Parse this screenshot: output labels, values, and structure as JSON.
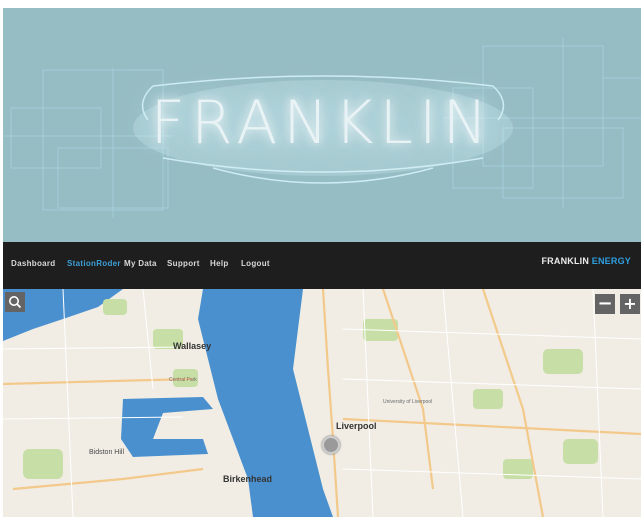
{
  "header": {
    "logo_text": "FRANKLIN"
  },
  "nav": {
    "items": [
      {
        "label": "Dashboard",
        "active": false
      },
      {
        "label": "StationRoder",
        "active": true
      },
      {
        "label": "My Data",
        "active": false
      },
      {
        "label": "Support",
        "active": false
      },
      {
        "label": "Help",
        "active": false
      },
      {
        "label": "Logout",
        "active": false
      }
    ],
    "brand_part1": "FRANKLIN",
    "brand_part2": "ENERGY"
  },
  "map": {
    "search_icon": "search-icon",
    "zoom_out_label": "−",
    "zoom_in_label": "+",
    "labels": {
      "wallasey": "Wallasey",
      "liverpool": "Liverpool",
      "birkenhead": "Birkenhead",
      "bidston_hill": "Bidston Hill",
      "central_park": "Central Park",
      "university": "University of Liverpool"
    },
    "marker": "station-marker"
  },
  "colors": {
    "hero_bg": "#96bcc4",
    "nav_bg": "#1e1e1e",
    "nav_active": "#3c9fd6",
    "brand_accent": "#2f9fe0",
    "water": "#4a90cf",
    "land": "#f1ede4",
    "park": "#c7dfa6"
  }
}
